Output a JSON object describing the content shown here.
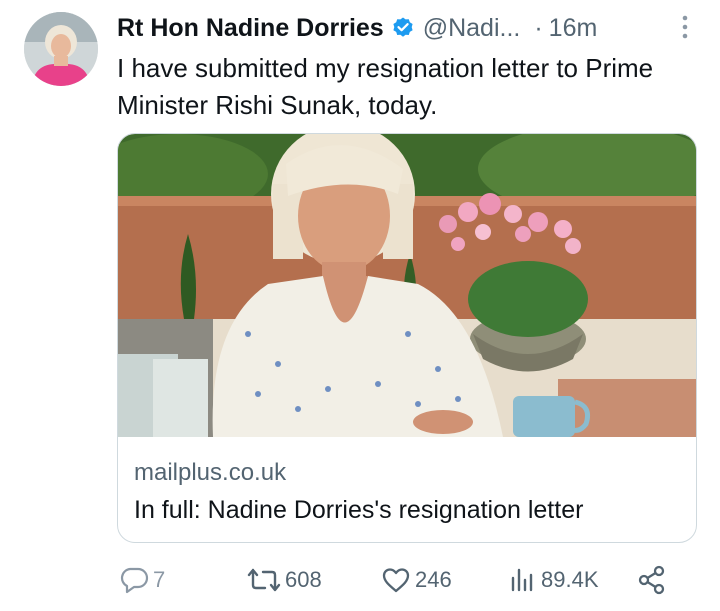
{
  "tweet": {
    "author_name": "Rt Hon Nadine Dorries",
    "handle": "@Nadi...",
    "separator": "·",
    "time": "16m",
    "text": "I have submitted my resignation letter to Prime Minister Rishi Sunak, today.",
    "verified": true
  },
  "card": {
    "domain": "mailplus.co.uk",
    "title": "In full: Nadine Dorries's resignation letter"
  },
  "actions": {
    "replies": "7",
    "reposts": "608",
    "likes": "246",
    "views": "89.4K"
  },
  "colors": {
    "verified_blue": "#1d9bf0",
    "secondary_text": "#536471",
    "border": "#cfd9de"
  },
  "icons": [
    "verified-badge-icon",
    "more-icon",
    "reply-icon",
    "repost-icon",
    "like-icon",
    "views-icon",
    "share-icon"
  ]
}
